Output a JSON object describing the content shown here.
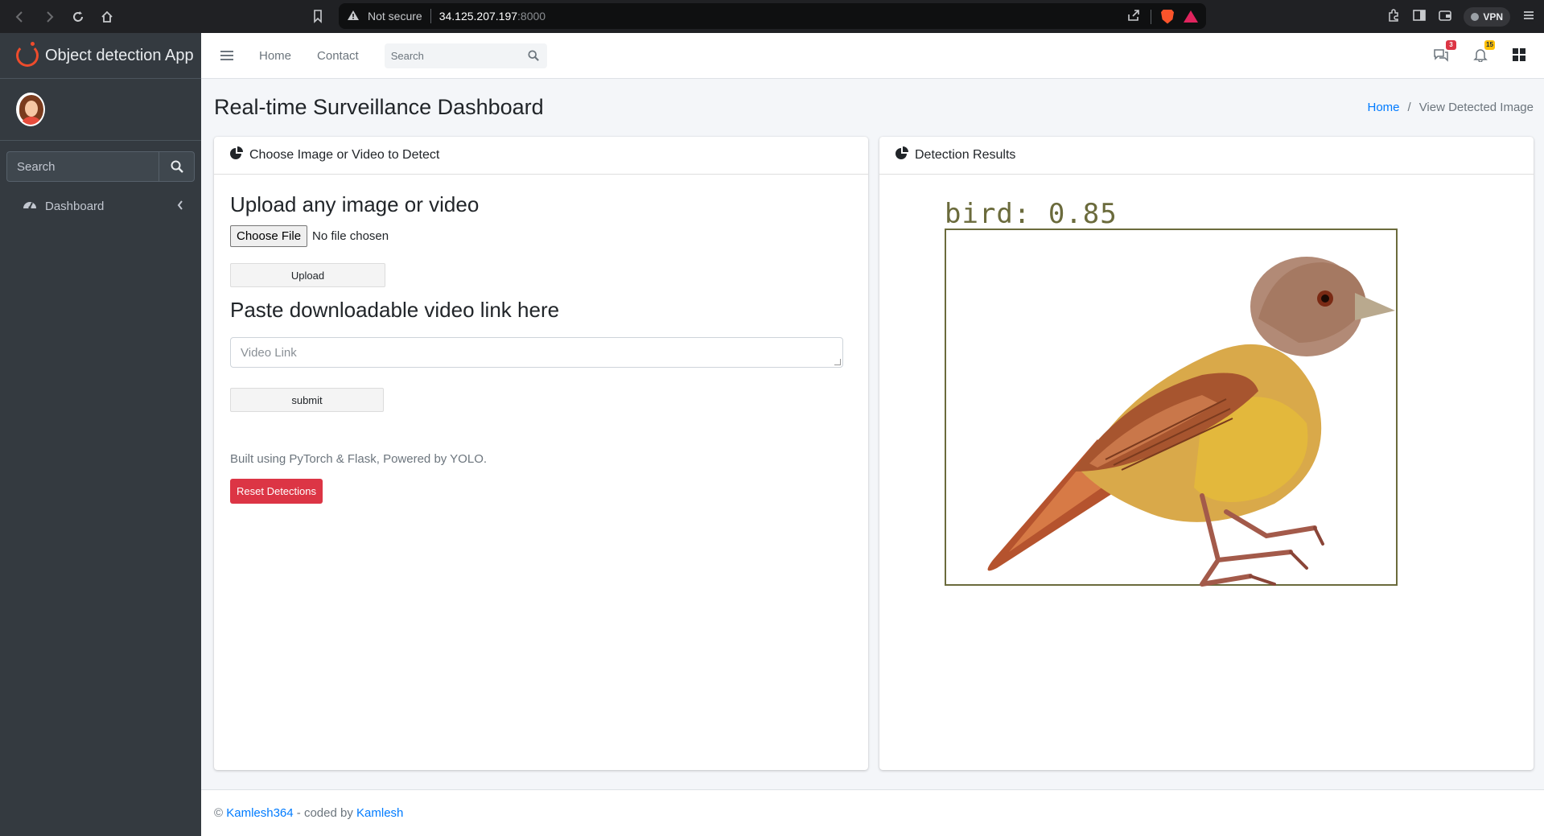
{
  "browser": {
    "security_label": "Not secure",
    "host": "34.125.207.197",
    "port": ":8000",
    "vpn_label": "VPN"
  },
  "sidebar": {
    "brand": "Object detection App",
    "search_placeholder": "Search",
    "items": [
      {
        "label": "Dashboard",
        "icon": "tachometer-icon"
      }
    ]
  },
  "topnav": {
    "links": [
      "Home",
      "Contact"
    ],
    "search_placeholder": "Search",
    "messages_badge": "3",
    "notifications_badge": "15"
  },
  "header": {
    "title": "Real-time Surveillance Dashboard",
    "breadcrumb": [
      "Home",
      "View Detected Image"
    ]
  },
  "left_card": {
    "title": "Choose Image or Video to Detect",
    "upload_heading": "Upload any image or video",
    "choose_file_label": "Choose File",
    "file_status": "No file chosen",
    "upload_button": "Upload",
    "paste_heading": "Paste downloadable video link here",
    "video_placeholder": "Video Link",
    "submit_button": "submit",
    "footnote": "Built using PyTorch & Flask, Powered by YOLO.",
    "reset_button": "Reset Detections"
  },
  "right_card": {
    "title": "Detection Results",
    "detection_label": "bird:  0.85"
  },
  "footer": {
    "copyright": "©",
    "author_link": "Kamlesh364",
    "middle_text": " - coded by ",
    "coder_link": "Kamlesh"
  },
  "colors": {
    "sidebar_bg": "#343a40",
    "accent_link": "#007bff",
    "danger": "#dc3545",
    "badge_red": "#dc3545",
    "badge_yellow": "#ffc107",
    "detect_box": "#6b6b3c"
  }
}
